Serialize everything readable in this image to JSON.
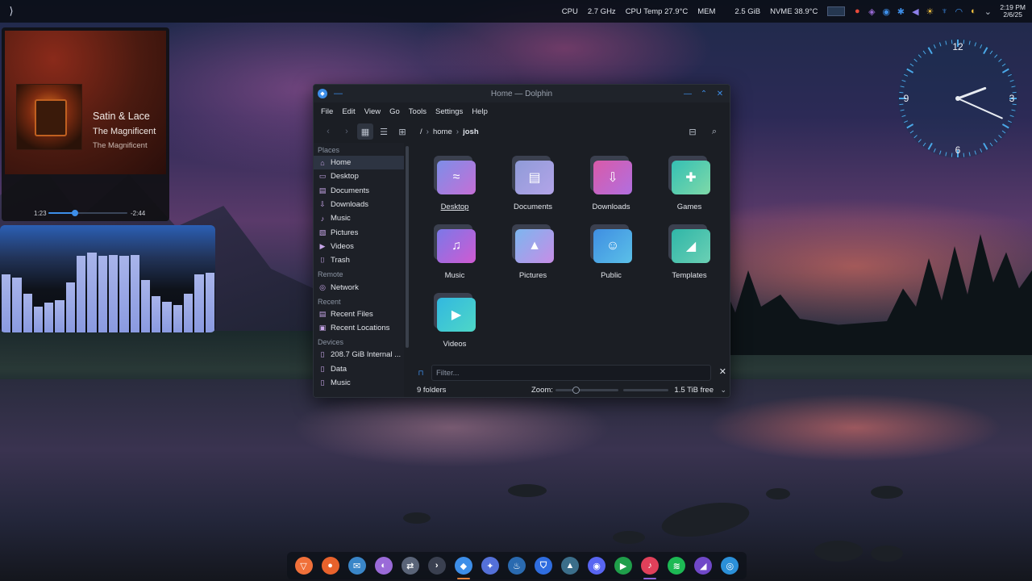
{
  "topbar": {
    "launcher_icon": "kde-launcher-icon",
    "stats": {
      "cpu_label": "CPU",
      "cpu_freq": "2.7 GHz",
      "cpu_temp": "CPU Temp 27.9°C",
      "mem_label": "MEM",
      "mem_value": "2.5 GiB",
      "nvme_temp": "NVME 38.9°C"
    },
    "clock": {
      "time": "2:19 PM",
      "date": "2/6/25"
    }
  },
  "media": {
    "title": "Satin & Lace",
    "album": "The Magnificent",
    "artist": "The Magnificent",
    "position": "1:23",
    "remaining": "-2:44",
    "progress_fraction": 0.34,
    "accent": "#3d8ee8",
    "pause_color": "#e0b64a"
  },
  "visualizer": {
    "levels": [
      0.72,
      0.68,
      0.48,
      0.32,
      0.37,
      0.4,
      0.62,
      0.95,
      0.99,
      0.95,
      0.96,
      0.95,
      0.96,
      0.65,
      0.45,
      0.38,
      0.34,
      0.48,
      0.72,
      0.74
    ]
  },
  "dolphin": {
    "title": "Home — Dolphin",
    "menu": [
      "File",
      "Edit",
      "View",
      "Go",
      "Tools",
      "Settings",
      "Help"
    ],
    "breadcrumb": [
      "/",
      "home",
      "josh"
    ],
    "sidebar": {
      "places_header": "Places",
      "places": [
        {
          "label": "Home",
          "icon": "home-icon"
        },
        {
          "label": "Desktop",
          "icon": "desktop-icon"
        },
        {
          "label": "Documents",
          "icon": "documents-icon"
        },
        {
          "label": "Downloads",
          "icon": "downloads-icon"
        },
        {
          "label": "Music",
          "icon": "music-icon"
        },
        {
          "label": "Pictures",
          "icon": "pictures-icon"
        },
        {
          "label": "Videos",
          "icon": "videos-icon"
        },
        {
          "label": "Trash",
          "icon": "trash-icon"
        }
      ],
      "remote_header": "Remote",
      "remote": [
        {
          "label": "Network",
          "icon": "network-icon"
        }
      ],
      "recent_header": "Recent",
      "recent": [
        {
          "label": "Recent Files",
          "icon": "recent-files-icon"
        },
        {
          "label": "Recent Locations",
          "icon": "recent-locations-icon"
        }
      ],
      "devices_header": "Devices",
      "devices": [
        {
          "label": "208.7 GiB Internal ...",
          "icon": "drive-icon"
        },
        {
          "label": "Data",
          "icon": "drive-icon"
        },
        {
          "label": "Music",
          "icon": "drive-icon"
        }
      ]
    },
    "folders": [
      {
        "label": "Desktop",
        "icon": "desktop-folder-icon",
        "colors": [
          "#7d8ee8",
          "#c56fd6"
        ]
      },
      {
        "label": "Documents",
        "icon": "documents-folder-icon",
        "colors": [
          "#8f9bd8",
          "#b3a4e8"
        ]
      },
      {
        "label": "Downloads",
        "icon": "downloads-folder-icon",
        "colors": [
          "#d95aa8",
          "#b16fe0"
        ]
      },
      {
        "label": "Games",
        "icon": "games-folder-icon",
        "colors": [
          "#34c0b4",
          "#7fd9a8"
        ]
      },
      {
        "label": "Music",
        "icon": "music-folder-icon",
        "colors": [
          "#7b78e8",
          "#d05ad2"
        ]
      },
      {
        "label": "Pictures",
        "icon": "pictures-folder-icon",
        "colors": [
          "#7cb6ef",
          "#c78de6"
        ]
      },
      {
        "label": "Public",
        "icon": "public-folder-icon",
        "colors": [
          "#3f8ee2",
          "#5bc0e8"
        ]
      },
      {
        "label": "Templates",
        "icon": "templates-folder-icon",
        "colors": [
          "#2fb6a8",
          "#6bd0b4"
        ]
      },
      {
        "label": "Videos",
        "icon": "videos-folder-icon",
        "colors": [
          "#32b8e0",
          "#4ed7c7"
        ]
      }
    ],
    "filter_placeholder": "Filter...",
    "status": {
      "count": "9 folders",
      "zoom_label": "Zoom:",
      "free_space": "1.5 TiB free",
      "zoom_fraction": 0.32
    }
  },
  "analog_clock": {
    "numbers": [
      "12",
      "3",
      "6",
      "9"
    ],
    "hour": 2,
    "minute": 19,
    "accent": "#4aa8e8"
  },
  "dock": {
    "apps": [
      {
        "name": "brave-icon",
        "color": "#f0703a",
        "glyph": "▽"
      },
      {
        "name": "firefox-icon",
        "color": "#e8622c",
        "glyph": "●"
      },
      {
        "name": "thunderbird-icon",
        "color": "#3a86c8",
        "glyph": "✉"
      },
      {
        "name": "color-picker-icon",
        "color": "#9a6ad8",
        "glyph": "◐"
      },
      {
        "name": "system-settings-icon",
        "color": "#5a6478",
        "glyph": "⇄"
      },
      {
        "name": "terminal-icon",
        "color": "#3a4050",
        "glyph": "›"
      },
      {
        "name": "dolphin-icon",
        "color": "#3d8ee8",
        "glyph": "◆",
        "running": true
      },
      {
        "name": "krita-icon",
        "color": "#5470d8",
        "glyph": "✦"
      },
      {
        "name": "steam-icon",
        "color": "#2a6ab0",
        "glyph": "♨"
      },
      {
        "name": "bitwarden-icon",
        "color": "#2f6de0",
        "glyph": "⛉"
      },
      {
        "name": "heroic-icon",
        "color": "#3b6e8a",
        "glyph": "▲"
      },
      {
        "name": "discord-icon",
        "color": "#5865f2",
        "glyph": "◉"
      },
      {
        "name": "media-play-icon",
        "color": "#1f9e4a",
        "glyph": "▶"
      },
      {
        "name": "elisa-icon",
        "color": "#e0405a",
        "glyph": "♪",
        "playing": true
      },
      {
        "name": "spotify-icon",
        "color": "#1db954",
        "glyph": "≋"
      },
      {
        "name": "wallpaper-icon",
        "color": "#7048c8",
        "glyph": "◢"
      },
      {
        "name": "kde-connect-icon",
        "color": "#2b90d9",
        "glyph": "◎"
      }
    ]
  }
}
